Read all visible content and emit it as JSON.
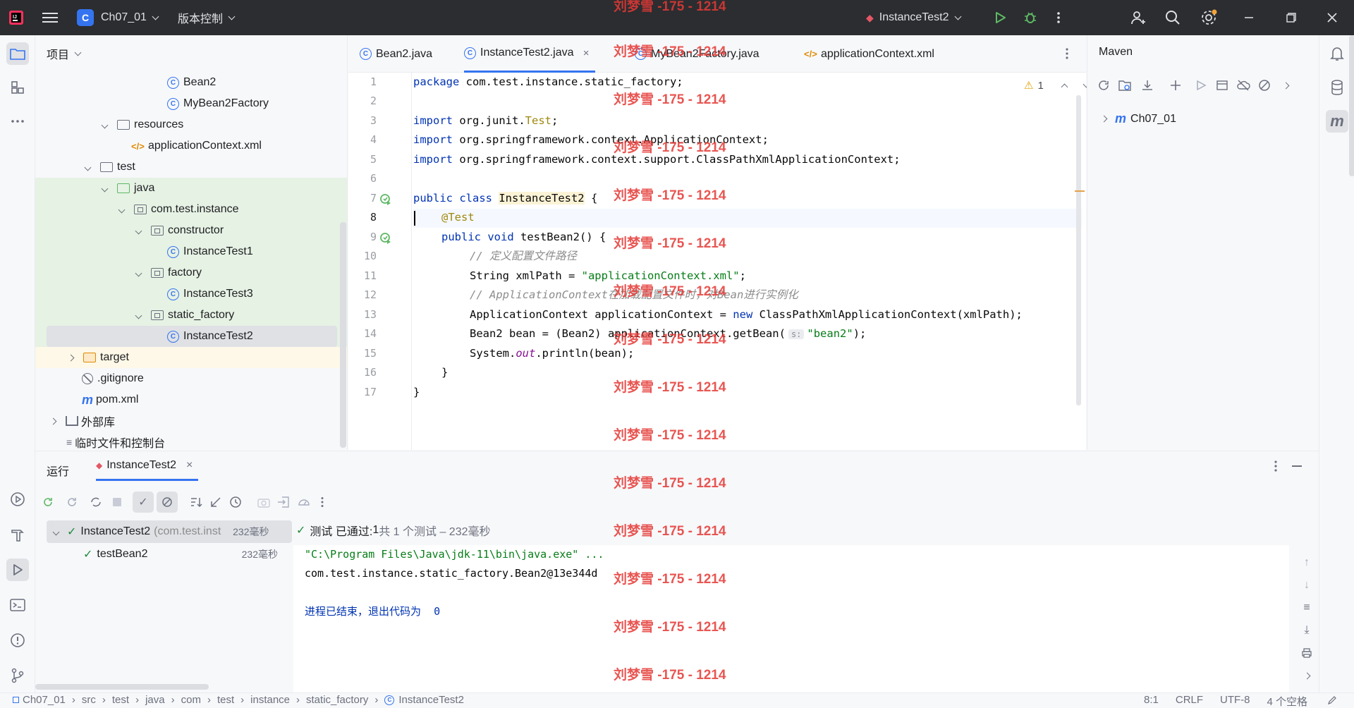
{
  "titlebar": {
    "project_initial": "C",
    "project_name": "Ch07_01",
    "vcs_label": "版本控制",
    "run_config": "InstanceTest2"
  },
  "project_panel": {
    "title": "项目",
    "tree": [
      {
        "label": "Bean2",
        "icon": "class-icon"
      },
      {
        "label": "MyBean2Factory",
        "icon": "class-icon"
      },
      {
        "label": "resources",
        "icon": "resources-folder-icon"
      },
      {
        "label": "applicationContext.xml",
        "icon": "xml-file-icon"
      },
      {
        "label": "test",
        "icon": "folder-icon"
      },
      {
        "label": "java",
        "icon": "test-folder-icon"
      },
      {
        "label": "com.test.instance",
        "icon": "package-icon"
      },
      {
        "label": "constructor",
        "icon": "package-icon"
      },
      {
        "label": "InstanceTest1",
        "icon": "class-icon"
      },
      {
        "label": "factory",
        "icon": "package-icon"
      },
      {
        "label": "InstanceTest3",
        "icon": "class-icon"
      },
      {
        "label": "static_factory",
        "icon": "package-icon"
      },
      {
        "label": "InstanceTest2",
        "icon": "class-icon"
      },
      {
        "label": "target",
        "icon": "folder-icon"
      },
      {
        "label": ".gitignore",
        "icon": "ignore-file-icon"
      },
      {
        "label": "pom.xml",
        "icon": "maven-file-icon"
      },
      {
        "label": "外部库",
        "icon": "library-icon"
      },
      {
        "label": "临时文件和控制台",
        "icon": "scratch-icon"
      }
    ]
  },
  "editor": {
    "tabs": [
      "Bean2.java",
      "InstanceTest2.java",
      "MyBean2Factory.java",
      "applicationContext.xml"
    ],
    "active_tab": "InstanceTest2.java",
    "warning_count": "1",
    "line_numbers": [
      "1",
      "2",
      "3",
      "4",
      "5",
      "6",
      "7",
      "8",
      "9",
      "10",
      "11",
      "12",
      "13",
      "14",
      "15",
      "16",
      "17"
    ],
    "code": {
      "l1_kw": "package",
      "l1_rest": " com.test.instance.static_factory;",
      "l3_kw": "import",
      "l3_a": " org.junit.",
      "l3_b": "Test",
      "l3_c": ";",
      "l4_kw": "import",
      "l4_rest": " org.springframework.context.ApplicationContext;",
      "l5_kw": "import",
      "l5_rest": " org.springframework.context.support.ClassPathXmlApplicationContext;",
      "l7_kw": "public class ",
      "l7_name": "InstanceTest2",
      "l7_rest": " {",
      "l8_ann": "@Test",
      "l9_kw": "public void ",
      "l9_rest": "testBean2() {",
      "l10_cmt": "// 定义配置文件路径",
      "l11_a": "String xmlPath = ",
      "l11_str": "\"applicationContext.xml\"",
      "l11_b": ";",
      "l12_cmt": "// ApplicationContext在加载配置文件时，对Bean进行实例化",
      "l13_a": "ApplicationContext applicationContext = ",
      "l13_kw": "new",
      "l13_b": " ClassPathXmlApplicationContext(xmlPath);",
      "l14_a": "Bean2 bean = (Bean2) applicationContext.getBean(",
      "l14_hint": "s:",
      "l14_str": "\"bean2\"",
      "l14_b": ");",
      "l15_a": "System.",
      "l15_fld": "out",
      "l15_b": ".println(bean);",
      "l16": "}",
      "l17": "}"
    }
  },
  "maven": {
    "title": "Maven",
    "root_item": "Ch07_01"
  },
  "run_panel": {
    "title": "运行",
    "tab": "InstanceTest2",
    "results": [
      {
        "name": "InstanceTest2",
        "detail": "(com.test.inst",
        "time": "232毫秒"
      },
      {
        "name": "testBean2",
        "detail": "",
        "time": "232毫秒"
      }
    ],
    "summary_prefix": "测试 已通过: ",
    "summary_count": "1",
    "summary_suffix": "共 1 个测试 – 232毫秒",
    "console": [
      "\"C:\\Program Files\\Java\\jdk-11\\bin\\java.exe\" ...",
      "com.test.instance.static_factory.Bean2@13e344d",
      "",
      "进程已结束，退出代码为  0"
    ]
  },
  "statusbar": {
    "breadcrumb": [
      "Ch07_01",
      "src",
      "test",
      "java",
      "com",
      "test",
      "instance",
      "static_factory",
      "InstanceTest2"
    ],
    "position": "8:1",
    "line_ending": "CRLF",
    "encoding": "UTF-8",
    "indent": "4 个空格"
  },
  "watermark": "刘梦雪 -175 - 1214",
  "colors": {
    "accent": "#3574f0",
    "test_green_bg": "#e6f2e4",
    "excluded_yellow_bg": "#fdf8e7",
    "watermark_red": "#e53935",
    "pass_green": "#208a3c"
  }
}
